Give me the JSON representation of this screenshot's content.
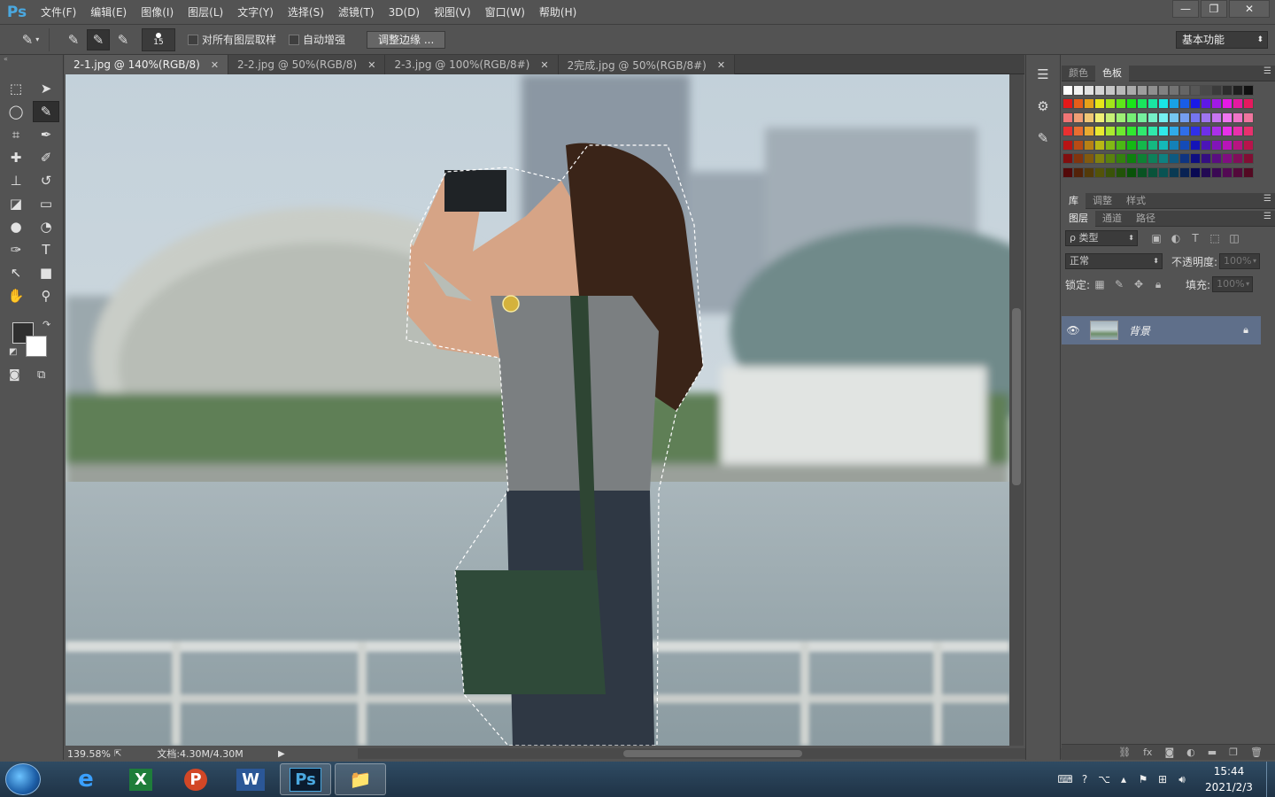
{
  "app": {
    "logo": "Ps"
  },
  "menu": [
    "文件(F)",
    "编辑(E)",
    "图像(I)",
    "图层(L)",
    "文字(Y)",
    "选择(S)",
    "滤镜(T)",
    "3D(D)",
    "视图(V)",
    "窗口(W)",
    "帮助(H)"
  ],
  "window_controls": {
    "minimize": "—",
    "restore": "❐",
    "close": "✕"
  },
  "options": {
    "brush_size": "15",
    "sample_all_layers": "对所有图层取样",
    "auto_enhance": "自动增强",
    "refine_edge": "调整边缘 ...",
    "workspace": "基本功能"
  },
  "doc_tabs": [
    {
      "label": "2-1.jpg @ 140%(RGB/8)",
      "active": true
    },
    {
      "label": "2-2.jpg @ 50%(RGB/8)",
      "active": false
    },
    {
      "label": "2-3.jpg @ 100%(RGB/8#)",
      "active": false
    },
    {
      "label": "2完成.jpg @ 50%(RGB/8#)",
      "active": false
    }
  ],
  "status": {
    "zoom": "139.58%",
    "doc_size": "文档:4.30M/4.30M"
  },
  "color_panel": {
    "tabs": [
      "颜色",
      "色板"
    ],
    "active": "色板"
  },
  "adjust_panel": {
    "tabs": [
      "库",
      "调整",
      "样式"
    ]
  },
  "layers_panel": {
    "tabs": [
      "图层",
      "通道",
      "路径"
    ],
    "filter_type": "ρ 类型",
    "blend_mode": "正常",
    "opacity_label": "不透明度:",
    "opacity_value": "100%",
    "lock_label": "锁定:",
    "fill_label": "填充:",
    "fill_value": "100%",
    "layer_name": "背景"
  },
  "taskbar": {
    "apps": [
      "e",
      "X",
      "P",
      "W",
      "Ps",
      "📁"
    ],
    "time": "15:44",
    "date": "2021/2/3"
  },
  "colors": {
    "ui_bg": "#535353",
    "selected_layer": "#5f6f8a",
    "ps_blue": "#4aa8e0"
  }
}
